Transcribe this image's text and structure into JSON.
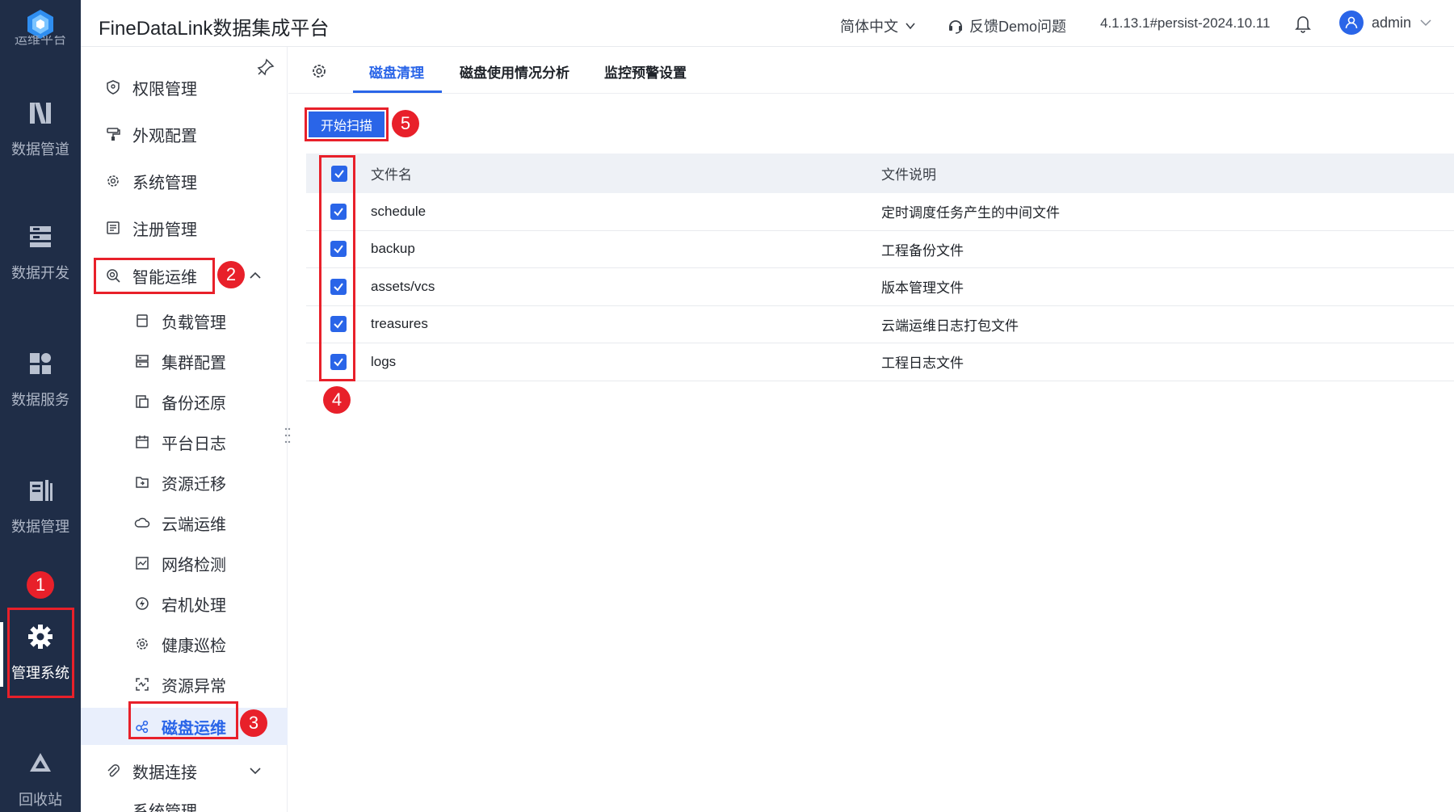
{
  "rail": {
    "partial_label": "运维平台",
    "items": [
      {
        "label": "数据管道",
        "icon": "pipeline-icon"
      },
      {
        "label": "数据开发",
        "icon": "dev-icon"
      },
      {
        "label": "数据服务",
        "icon": "service-icon"
      },
      {
        "label": "数据管理",
        "icon": "data-manage-icon"
      },
      {
        "label": "管理系统",
        "icon": "gear-icon",
        "active": true
      },
      {
        "label": "回收站",
        "icon": "recycle-icon"
      }
    ]
  },
  "header": {
    "title": "FineDataLink数据集成平台",
    "language": "简体中文",
    "feedback": "反馈Demo问题",
    "version": "4.1.13.1#persist-2024.10.11",
    "user": "admin"
  },
  "menu": {
    "top_items": [
      {
        "label": "权限管理"
      },
      {
        "label": "外观配置"
      },
      {
        "label": "系统管理"
      },
      {
        "label": "注册管理"
      },
      {
        "label": "智能运维"
      }
    ],
    "sub_items": [
      {
        "label": "负载管理"
      },
      {
        "label": "集群配置"
      },
      {
        "label": "备份还原"
      },
      {
        "label": "平台日志"
      },
      {
        "label": "资源迁移"
      },
      {
        "label": "云端运维"
      },
      {
        "label": "网络检测"
      },
      {
        "label": "宕机处理"
      },
      {
        "label": "健康巡检"
      },
      {
        "label": "资源异常"
      },
      {
        "label": "磁盘运维"
      }
    ],
    "bottom_item": {
      "label": "数据连接"
    },
    "cutoff_label": "系统管理"
  },
  "tabs": [
    {
      "label": "磁盘清理",
      "active": true
    },
    {
      "label": "磁盘使用情况分析"
    },
    {
      "label": "监控预警设置"
    }
  ],
  "scan_button": "开始扫描",
  "table": {
    "headers": {
      "name": "文件名",
      "desc": "文件说明"
    },
    "rows": [
      {
        "name": "schedule",
        "desc": "定时调度任务产生的中间文件",
        "checked": true
      },
      {
        "name": "backup",
        "desc": "工程备份文件",
        "checked": true
      },
      {
        "name": "assets/vcs",
        "desc": "版本管理文件",
        "checked": true
      },
      {
        "name": "treasures",
        "desc": "云端运维日志打包文件",
        "checked": true
      },
      {
        "name": "logs",
        "desc": "工程日志文件",
        "checked": true
      }
    ]
  },
  "annotations": [
    "1",
    "2",
    "3",
    "4",
    "5"
  ],
  "colors": {
    "rail_bg": "#1f2d47",
    "accent": "#2a65e8",
    "highlight": "#e8202a",
    "table_header_bg": "#eef1f6"
  }
}
